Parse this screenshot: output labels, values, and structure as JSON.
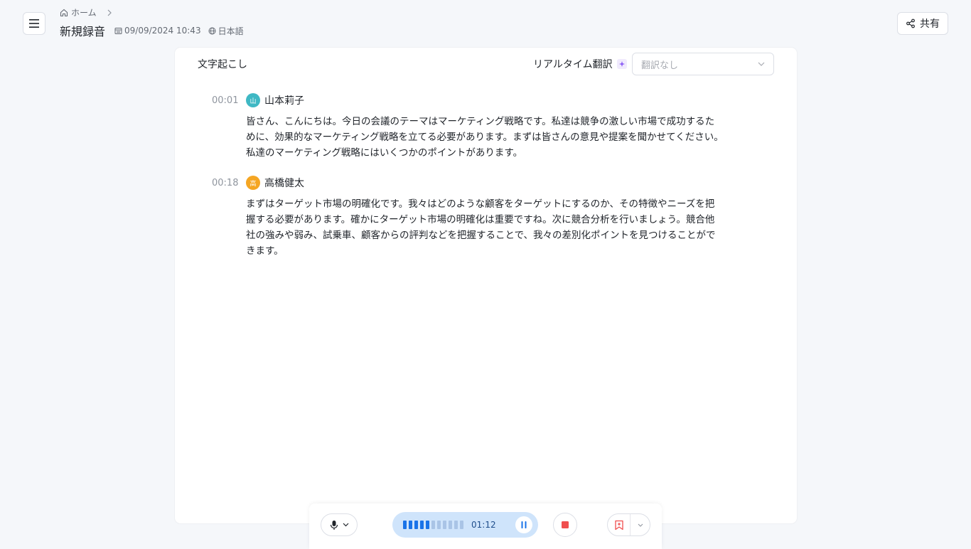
{
  "header": {
    "breadcrumb_home": "ホーム",
    "title": "新規録音",
    "datetime": "09/09/2024 10:43",
    "language": "日本語",
    "share_label": "共有"
  },
  "panel": {
    "title": "文字起こし",
    "realtime_translation_label": "リアルタイム翻訳",
    "translation_select_placeholder": "翻訳なし"
  },
  "segments": [
    {
      "time": "00:01",
      "avatar_char": "山",
      "avatar_color": "#3fb8c4",
      "speaker": "山本莉子",
      "text": "皆さん、こんにちは。今日の会議のテーマはマーケティング戦略です。私達は競争の激しい市場で成功するために、効果的なマーケティング戦略を立てる必要があります。まずは皆さんの意見や提案を聞かせてください。私達のマーケティング戦略にはいくつかのポイントがあります。"
    },
    {
      "time": "00:18",
      "avatar_char": "高",
      "avatar_color": "#f5a623",
      "speaker": "高橋健太",
      "text": "まずはターゲット市場の明確化です。我々はどのような顧客をターゲットにするのか、その特徴やニーズを把握する必要があります。確かにターゲット市場の明確化は重要ですね。次に競合分析を行いましょう。競合他社の強みや弱み、試乗車、顧客からの評判などを把握することで、我々の差別化ポイントを見つけることができます。"
    }
  ],
  "controls": {
    "elapsed": "01:12",
    "audio_level_active_bars": 5,
    "audio_level_total_bars": 11,
    "accent_color": "#1a73e8",
    "stop_color": "#f04e4e",
    "bookmark_color": "#f04e4e"
  }
}
